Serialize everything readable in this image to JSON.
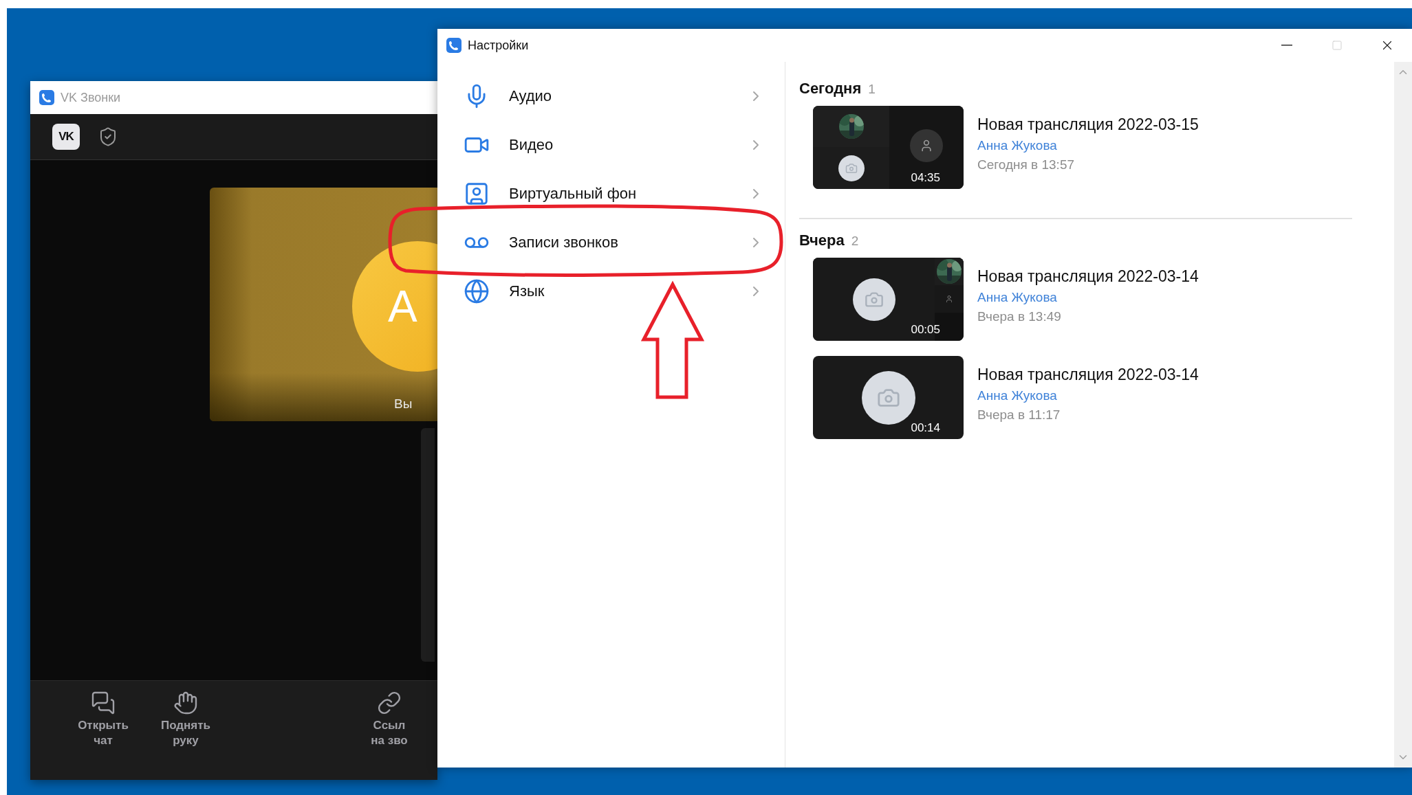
{
  "call_window": {
    "title": "VK Звонки",
    "logo": "VK",
    "self_tile": {
      "initial": "А",
      "label": "Вы"
    },
    "toolbar": [
      {
        "lines": [
          "Открыть",
          "чат"
        ]
      },
      {
        "lines": [
          "Поднять",
          "руку"
        ]
      },
      {
        "lines": [
          "Ссыл",
          "на зво"
        ]
      }
    ]
  },
  "settings_window": {
    "title": "Настройки",
    "controls": [
      {
        "kind": "minimize",
        "disabled": false
      },
      {
        "kind": "maximize",
        "disabled": true
      },
      {
        "kind": "close",
        "disabled": false
      }
    ],
    "menu": [
      {
        "label": "Аудио"
      },
      {
        "label": "Видео"
      },
      {
        "label": "Виртуальный фон"
      },
      {
        "label": "Записи звонков"
      },
      {
        "label": "Язык"
      }
    ],
    "groups": [
      {
        "title": "Сегодня",
        "count": "1",
        "recordings": [
          {
            "kind": "grid",
            "duration": "04:35",
            "title": "Новая трансляция 2022-03-15",
            "author": "Анна Жукова",
            "time": "Сегодня в 13:57"
          }
        ]
      },
      {
        "title": "Вчера",
        "count": "2",
        "recordings": [
          {
            "kind": "side",
            "duration": "00:05",
            "title": "Новая трансляция 2022-03-14",
            "author": "Анна Жукова",
            "time": "Вчера в 13:49"
          },
          {
            "kind": "single",
            "duration": "00:14",
            "title": "Новая трансляция 2022-03-14",
            "author": "Анна Жукова",
            "time": "Вчера в 11:17"
          }
        ]
      }
    ]
  },
  "annotation": {
    "ellipse": true,
    "arrow": true
  }
}
